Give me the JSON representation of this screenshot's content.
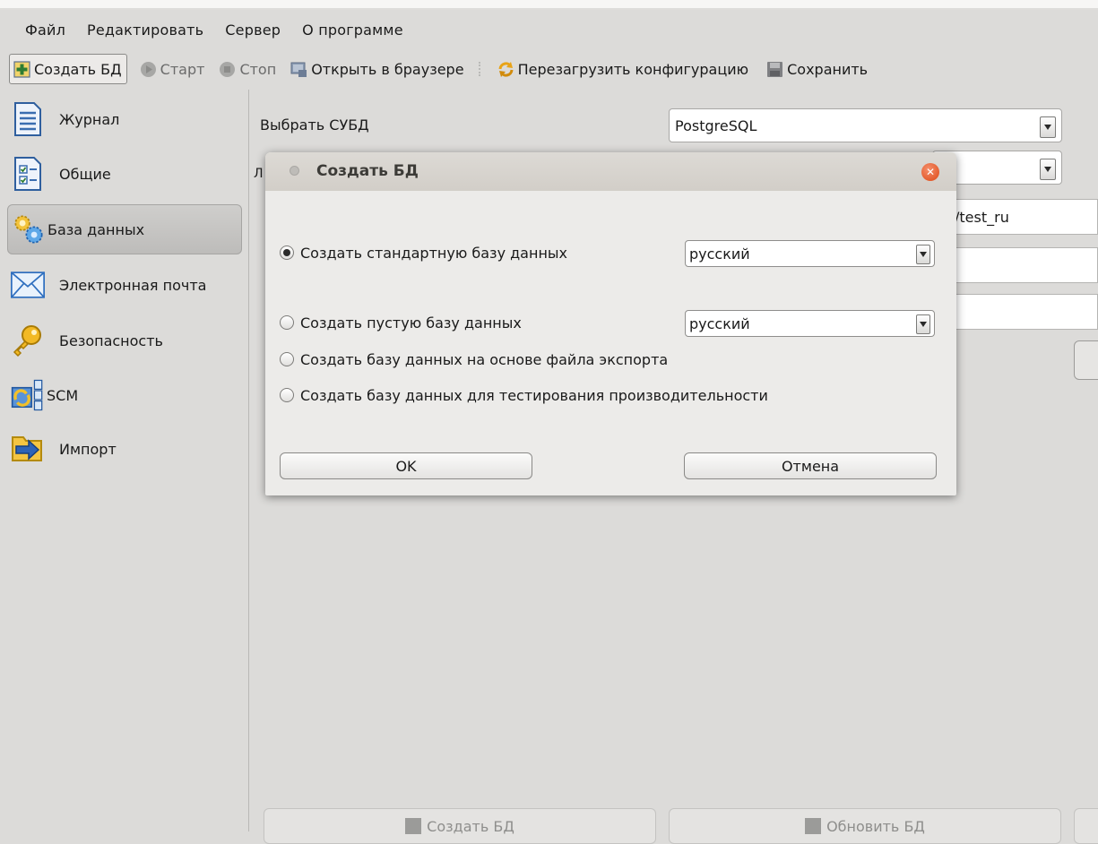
{
  "menubar": {
    "items": [
      "Файл",
      "Редактировать",
      "Сервер",
      "О программе"
    ]
  },
  "toolbar": {
    "create_db": "Создать БД",
    "start": "Старт",
    "stop": "Стоп",
    "open_browser": "Открыть в браузере",
    "reload_config": "Перезагрузить конфигурацию",
    "save": "Сохранить"
  },
  "sidebar": {
    "items": [
      {
        "label": "Журнал",
        "icon": "journal-icon"
      },
      {
        "label": "Общие",
        "icon": "general-settings-icon"
      },
      {
        "label": "База данных",
        "icon": "database-gears-icon",
        "active": true
      },
      {
        "label": "Электронная почта",
        "icon": "envelope-icon"
      },
      {
        "label": "Безопасность",
        "icon": "key-icon"
      },
      {
        "label": "SCM",
        "icon": "scm-icon"
      },
      {
        "label": "Импорт",
        "icon": "import-icon"
      }
    ]
  },
  "main": {
    "dbms_label": "Выбрать СУБД",
    "dbms_value": "PostgreSQL",
    "url_partial": "/test_ru",
    "bottom_create": "Создать БД",
    "bottom_update": "Обновить БД"
  },
  "dialog": {
    "title": "Создать БД",
    "options": [
      {
        "label": "Создать стандартную базу данных",
        "checked": true,
        "language": "русский"
      },
      {
        "label": "Создать пустую базу данных",
        "checked": false,
        "language": "русский"
      },
      {
        "label": "Создать базу данных на основе файла экспорта",
        "checked": false
      },
      {
        "label": "Создать базу данных для тестирования производительности",
        "checked": false
      }
    ],
    "ok": "OK",
    "cancel": "Отмена"
  },
  "colors": {
    "background": "#dcdbd9",
    "close_button": "#dd4814",
    "dialog_bg": "#ecebe9"
  }
}
